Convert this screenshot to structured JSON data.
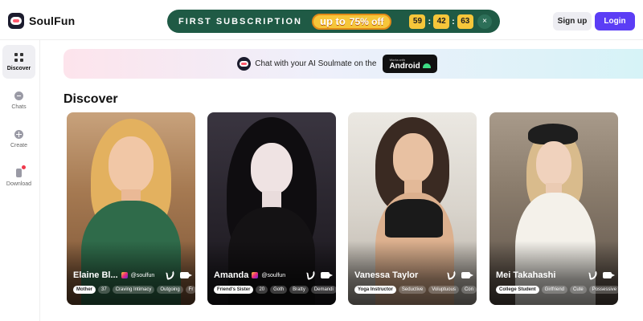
{
  "brand": {
    "name": "SoulFun"
  },
  "promo": {
    "first_label": "FIRST SUBSCRIPTION",
    "up_to": "up to",
    "discount": "75% off",
    "countdown": [
      "59",
      "42",
      "63"
    ],
    "close_symbol": "×"
  },
  "auth": {
    "signup_label": "Sign up",
    "login_label": "Login"
  },
  "sidebar": {
    "items": [
      {
        "label": "Discover",
        "icon": "grid-icon",
        "active": true
      },
      {
        "label": "Chats",
        "icon": "chat-icon",
        "active": false
      },
      {
        "label": "Create",
        "icon": "plus-icon",
        "active": false
      },
      {
        "label": "Download",
        "icon": "phone-icon",
        "active": false
      }
    ]
  },
  "banner": {
    "text": "Chat with your AI Soulmate on the",
    "badge_small": "Works with",
    "badge_big": "Android"
  },
  "section": {
    "title": "Discover"
  },
  "cards": [
    {
      "name": "Elaine Bl...",
      "handle": "@soulfun",
      "tags": [
        "Mother",
        "37",
        "Craving Intimacy",
        "Outgoing",
        "Fr"
      ]
    },
    {
      "name": "Amanda",
      "handle": "@soulfun",
      "tags": [
        "Friend's Sister",
        "20",
        "Goth",
        "Bratty",
        "Demandi"
      ]
    },
    {
      "name": "Vanessa Taylor",
      "handle": "",
      "tags": [
        "Yoga Instructor",
        "Seductive",
        "Voluptuous",
        "Con"
      ]
    },
    {
      "name": "Mei Takahashi",
      "handle": "",
      "tags": [
        "College Student",
        "Girlfriend",
        "Cute",
        "Possessive"
      ]
    }
  ],
  "colors": {
    "accent": "#5b3df5",
    "promo_bg": "#1f5a45",
    "promo_gold": "#f6c63a"
  }
}
